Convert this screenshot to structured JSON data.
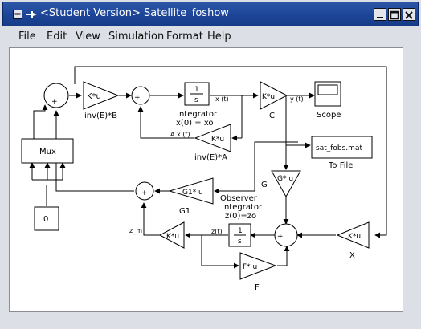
{
  "window": {
    "title": "<Student Version> Satellite_foshow",
    "controls": [
      "minimize",
      "maximize",
      "close"
    ]
  },
  "menu": [
    {
      "label": "File"
    },
    {
      "label": "Edit"
    },
    {
      "label": "View"
    },
    {
      "label": "Simulation"
    },
    {
      "label": "Format"
    },
    {
      "label": "Help"
    }
  ],
  "blocks": {
    "gain_invEB": {
      "text": "K*u",
      "caption": "inv(E)*B"
    },
    "sum1": {
      "text": "+"
    },
    "sum2": {
      "text": "+"
    },
    "integrator": {
      "num": "1",
      "den": "s",
      "caption1": "Integrator",
      "caption2": "x(0) = xo"
    },
    "gain_C": {
      "text": "K*u",
      "caption": "C"
    },
    "scope": {
      "caption": "Scope"
    },
    "gain_invEA": {
      "text": "K*u",
      "caption": "inv(E)*A"
    },
    "mux": {
      "text": "Mux"
    },
    "const0": {
      "text": "0"
    },
    "tofile": {
      "text": "sat_fobs.mat",
      "caption": "To File"
    },
    "gain_G": {
      "text": "G* u",
      "caption": "G"
    },
    "gain_G1": {
      "text": "G1* u",
      "caption": "G1"
    },
    "sum3": {
      "text": "+"
    },
    "observer_integrator": {
      "num": "1",
      "den": "s",
      "caption1": "Observer",
      "caption2": "Integrator",
      "caption3": "z(0)=zo"
    },
    "gain_K": {
      "text": "K*u"
    },
    "sum4": {
      "text": "+"
    },
    "gain_X": {
      "text": "K*u",
      "caption": "X"
    },
    "gain_F": {
      "text": "F* u",
      "caption": "F"
    }
  },
  "signals": {
    "xt": "x (t)",
    "yt": "y (t)",
    "axt": "A x (t)",
    "zt": "z(t)",
    "zm": "z_m"
  }
}
